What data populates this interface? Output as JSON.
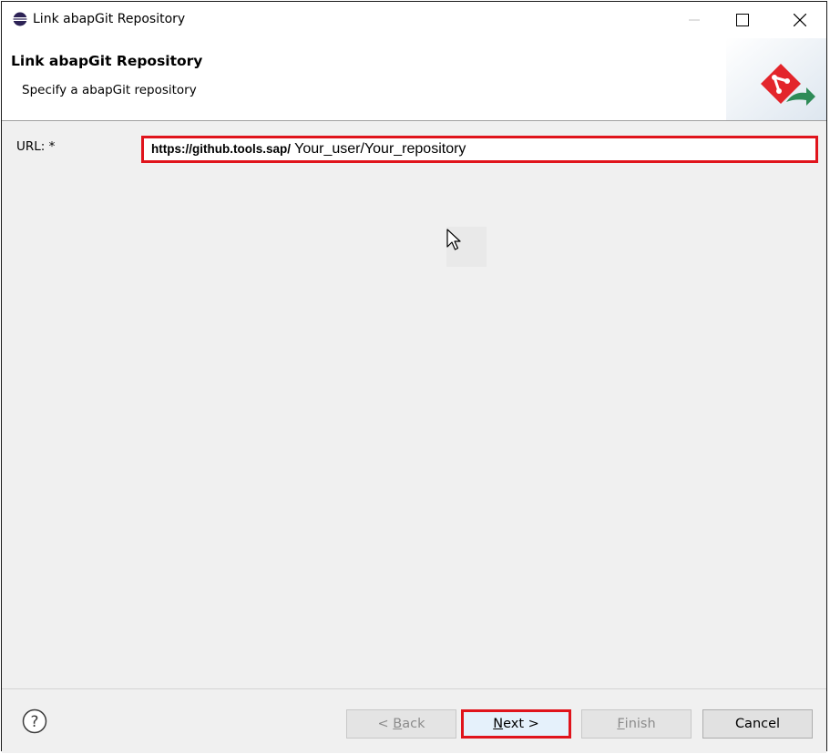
{
  "window": {
    "title": "Link abapGit Repository"
  },
  "banner": {
    "title": "Link abapGit Repository",
    "subtitle": "Specify a abapGit repository",
    "logo_icon": "abapgit-link-icon"
  },
  "form": {
    "url_label": "URL: *",
    "url_base": "https://github.tools.sap/",
    "url_rest": " Your_user/Your_repository"
  },
  "footer": {
    "help_icon": "help-icon",
    "back_prefix": "< ",
    "back_mnemonic": "B",
    "back_rest": "ack",
    "next_mnemonic": "N",
    "next_rest": "ext >",
    "finish_mnemonic": "F",
    "finish_rest": "inish",
    "cancel_label": "Cancel"
  },
  "colors": {
    "highlight": "#e0141c",
    "abapgit_red": "#e3252b",
    "link_green": "#2e8b57"
  }
}
